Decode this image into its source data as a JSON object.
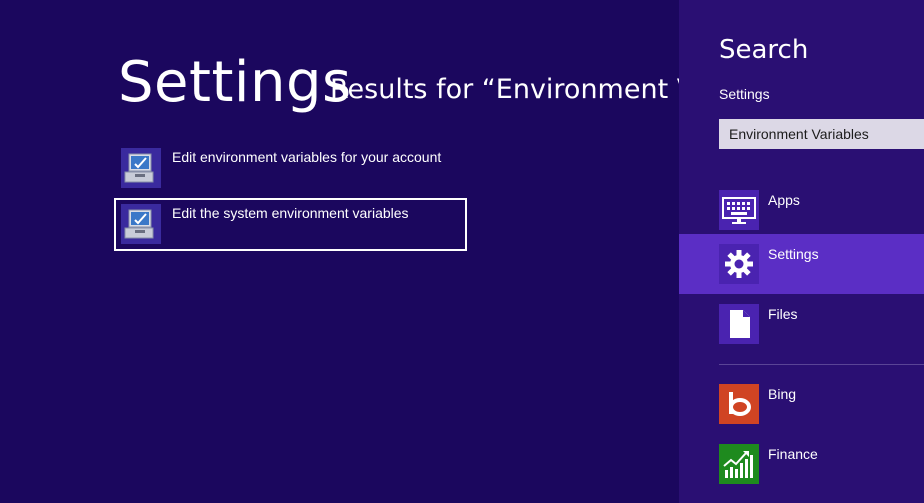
{
  "main": {
    "title": "Settings",
    "results_for": "Results for “Environment Variables”",
    "results": [
      {
        "label": "Edit environment variables for your account",
        "icon": "system-properties-icon"
      },
      {
        "label": "Edit the system environment variables",
        "icon": "system-properties-icon"
      }
    ]
  },
  "search_pane": {
    "title": "Search",
    "scope": "Settings",
    "query": "Environment Variables",
    "categories": [
      {
        "label": "Apps",
        "icon": "keyboard-icon",
        "color": "#4a23b0"
      },
      {
        "label": "Settings",
        "icon": "gear-icon",
        "color": "#4a23b0",
        "selected": true
      },
      {
        "label": "Files",
        "icon": "document-icon",
        "color": "#4a23b0"
      },
      {
        "label": "Bing",
        "icon": "bing-icon",
        "color": "#d04423"
      },
      {
        "label": "Finance",
        "icon": "finance-chart-icon",
        "color": "#1e8a1e"
      }
    ]
  },
  "colors": {
    "background": "#1b075e",
    "pane": "#2a0f73",
    "selected": "#5b2ec5"
  }
}
